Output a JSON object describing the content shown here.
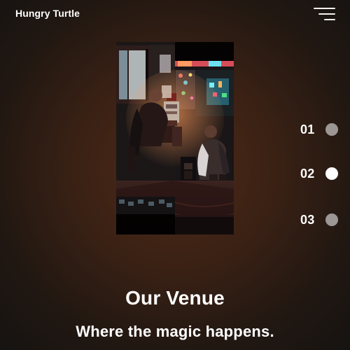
{
  "header": {
    "brand": "Hungry Turtle",
    "menu_icon": "menu-icon"
  },
  "hero": {
    "image_label": "venue-photo"
  },
  "slides": [
    {
      "label": "01",
      "active": false
    },
    {
      "label": "02",
      "active": true
    },
    {
      "label": "03",
      "active": false
    }
  ],
  "content": {
    "title": "Our Venue",
    "subtitle": "Where the magic happens."
  },
  "colors": {
    "text": "#ffffff",
    "active_dot": "#ffffff",
    "inactive_dot": "#9c9795",
    "background": "#3a2115"
  }
}
